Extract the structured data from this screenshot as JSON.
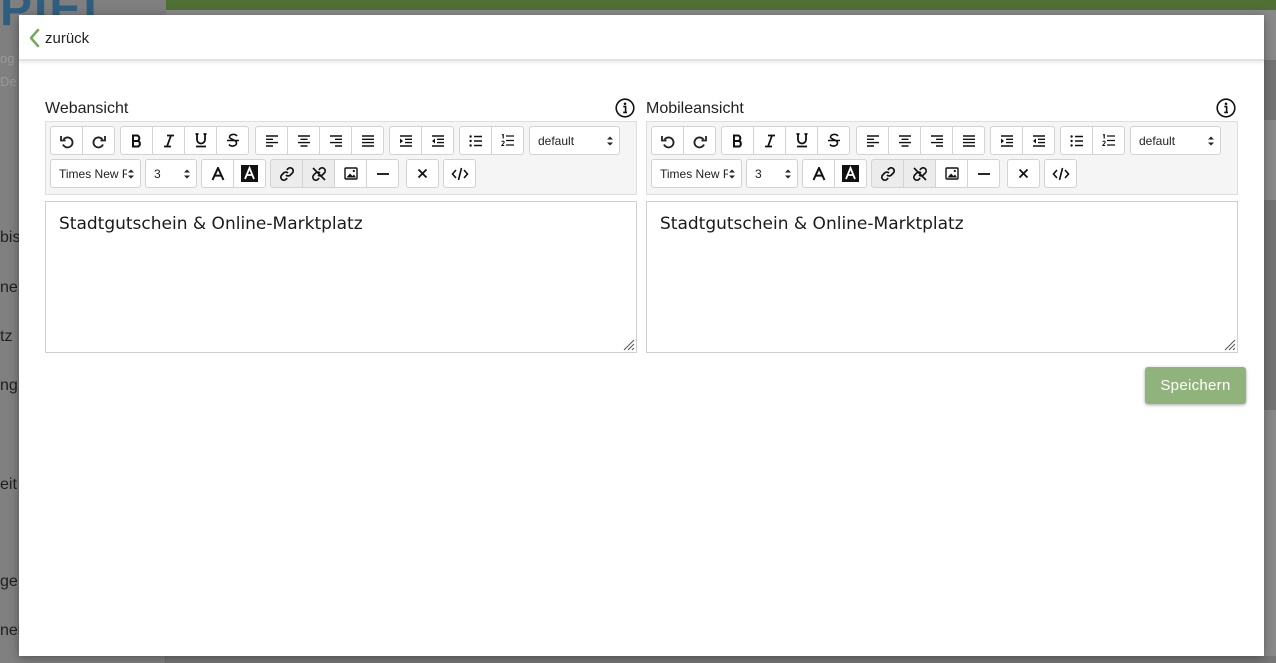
{
  "background_page": {
    "logo": "PIEL",
    "sidebar_fragments": [
      "bis",
      "ne",
      "tz",
      "ng",
      "eit",
      "ge",
      "nei"
    ],
    "sidebar_small_fragments": [
      "og",
      "De"
    ]
  },
  "modal": {
    "back_label": "zurück",
    "save_label": "Speichern",
    "accent_color": "#8fb37a"
  },
  "editors": [
    {
      "title": "Webansicht",
      "content": "Stadtgutschein & Online-Marktplatz",
      "format_select": "default",
      "font_select": "Times New R",
      "size_select": "3"
    },
    {
      "title": "Mobileansicht",
      "content": "Stadtgutschein & Online-Marktplatz",
      "format_select": "default",
      "font_select": "Times New R",
      "size_select": "3"
    }
  ],
  "toolbar_icons": [
    "undo-icon",
    "redo-icon",
    "bold-icon",
    "italic-icon",
    "underline-icon",
    "strikethrough-icon",
    "align-left-icon",
    "align-center-icon",
    "align-right-icon",
    "align-justify-icon",
    "indent-icon",
    "outdent-icon",
    "bullet-list-icon",
    "numbered-list-icon",
    "text-color-icon",
    "background-color-icon",
    "link-icon",
    "unlink-icon",
    "image-icon",
    "horizontal-rule-icon",
    "remove-format-icon",
    "source-code-icon"
  ]
}
